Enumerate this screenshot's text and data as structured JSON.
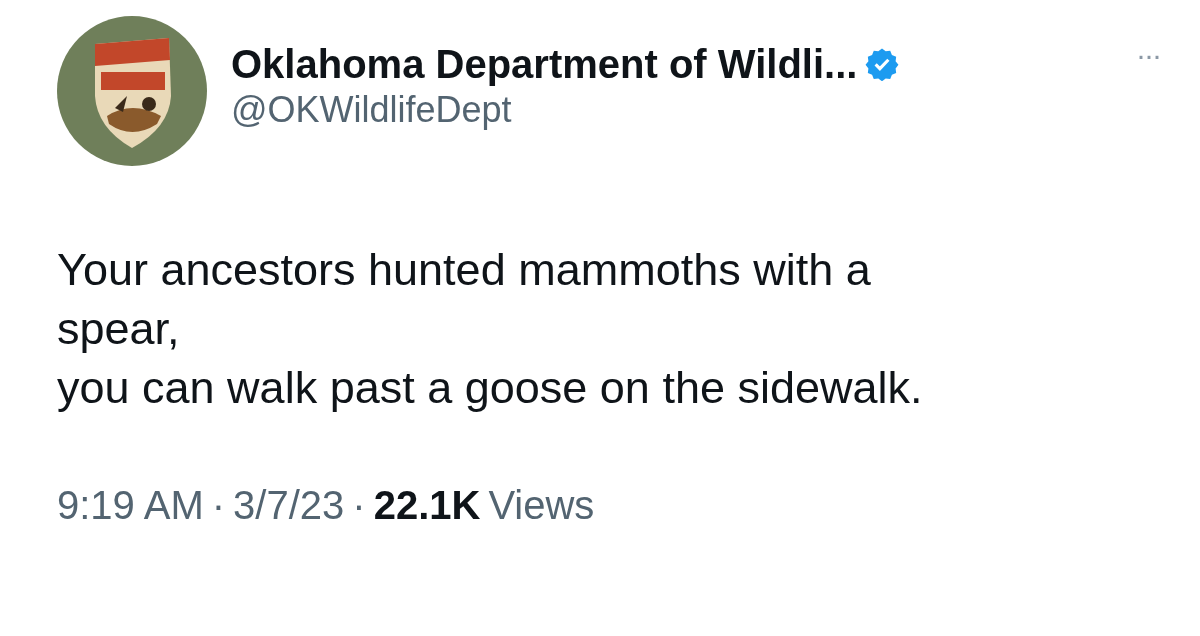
{
  "author": {
    "name": "Oklahoma Department of Wildli...",
    "handle": "@OKWildlifeDept",
    "verified": true
  },
  "more_button": "···",
  "text_lines": [
    "Your ancestors hunted mammoths with a",
    "spear,",
    "you can walk past a goose on the sidewalk."
  ],
  "meta": {
    "time": "9:19 AM",
    "separator_1": "·",
    "date": "3/7/23",
    "separator_2": "·",
    "views_count": "22.1K",
    "views_label": "Views"
  }
}
